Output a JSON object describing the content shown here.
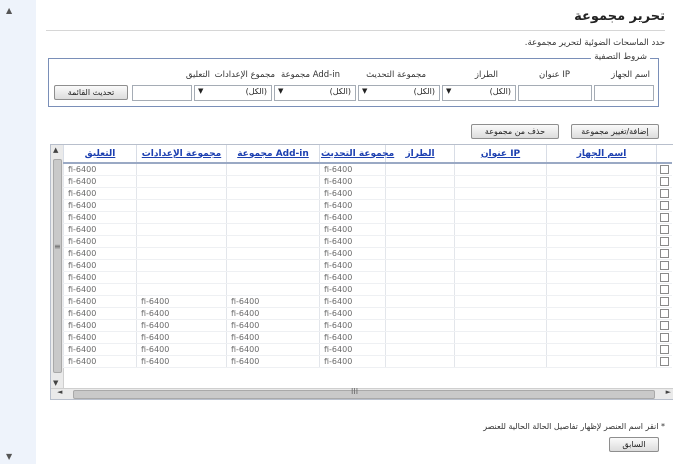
{
  "title": "تحرير مجموعة",
  "description": "حدد الماسحات الضوئية لتحرير مجموعة.",
  "filter": {
    "legend": "شروط التصفية",
    "labels": {
      "device_name": "اسم الجهاز",
      "ip": "عنوان IP",
      "model": "الطراز",
      "update_group": "مجموعة التحديث",
      "addin_group": "مجموعة Add-in",
      "settings_group": "مجموع الإعدادات",
      "comment": "التعليق"
    },
    "all_option": "(الكل)",
    "refresh_label": "تحديث القائمة"
  },
  "actions": {
    "add_change_label": "إضافة/تغيير مجموعة",
    "remove_label": "حذف من مجموعة"
  },
  "table": {
    "columns": [
      "اسم الجهاز",
      "عنوان IP",
      "الطراز",
      "مجموعة التحديث",
      "مجموعة Add-in",
      "مجموعة الإعدادات",
      "التعليق"
    ],
    "rows": [
      {
        "update": "fi-6400",
        "comment": "fi-6400"
      },
      {
        "update": "fi-6400",
        "comment": "fi-6400"
      },
      {
        "update": "fi-6400",
        "comment": "fi-6400"
      },
      {
        "update": "fi-6400",
        "comment": "fi-6400"
      },
      {
        "update": "fi-6400",
        "comment": "fi-6400"
      },
      {
        "update": "fi-6400",
        "comment": "fi-6400"
      },
      {
        "update": "fi-6400",
        "comment": "fi-6400"
      },
      {
        "update": "fi-6400",
        "comment": "fi-6400"
      },
      {
        "update": "fi-6400",
        "comment": "fi-6400"
      },
      {
        "update": "fi-6400",
        "comment": "fi-6400"
      },
      {
        "update": "fi-6400",
        "comment": "fi-6400"
      },
      {
        "update": "fi-6400",
        "addin": "fi-6400",
        "settings": "fi-6400",
        "comment": "fi-6400"
      },
      {
        "update": "fi-6400",
        "addin": "fi-6400",
        "settings": "fi-6400",
        "comment": "fi-6400"
      },
      {
        "update": "fi-6400",
        "addin": "fi-6400",
        "settings": "fi-6400",
        "comment": "fi-6400"
      },
      {
        "update": "fi-6400",
        "addin": "fi-6400",
        "settings": "fi-6400",
        "comment": "fi-6400"
      },
      {
        "update": "fi-6400",
        "addin": "fi-6400",
        "settings": "fi-6400",
        "comment": "fi-6400"
      },
      {
        "update": "fi-6400",
        "addin": "fi-6400",
        "settings": "fi-6400",
        "comment": "fi-6400"
      }
    ]
  },
  "hscroll_glyph": "III",
  "note": "* انقر اسم العنصر لإظهار تفاصيل الحالة الحالية للعنصر",
  "back_label": "السابق",
  "colors": {
    "link": "#1c3fb0",
    "border": "#7a8fb8"
  }
}
